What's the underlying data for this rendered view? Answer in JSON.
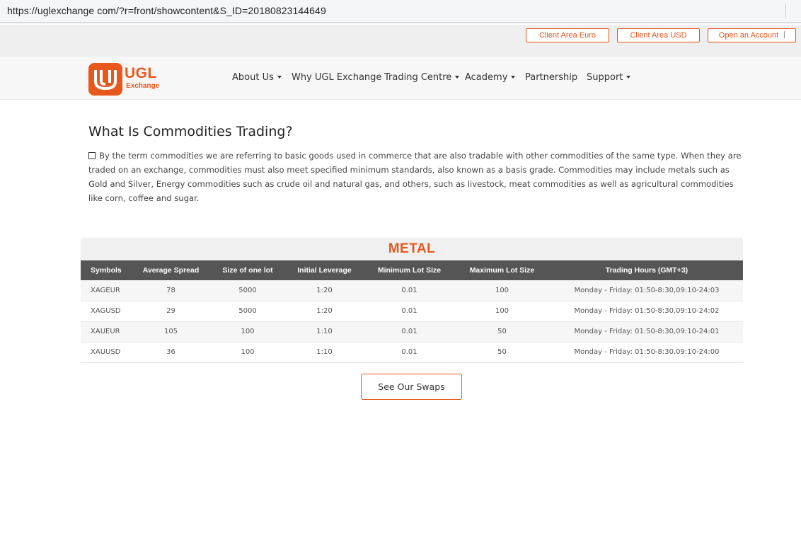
{
  "browser": {
    "url": "https://uglexchange com/?r=front/showcontent&S_ID=20180823144649"
  },
  "top_buttons": {
    "client_euro": "Client Area Euro",
    "client_usd": "Client Area USD",
    "open_account": "Open an Account"
  },
  "logo": {
    "name": "UGL",
    "sub": "Exchange",
    "color": "#e8581c"
  },
  "nav": {
    "about": "About Us",
    "why": "Why UGL Exchange",
    "trading": "Trading Centre",
    "academy": "Academy",
    "partnership": "Partnership",
    "support": "Support"
  },
  "content": {
    "heading": "What Is Commodities Trading?",
    "paragraph": "By the term commodities we are referring to basic goods used in commerce that are also tradable with other commodities of the same type. When they are traded on an exchange, commodities must also meet specified minimum standards, also known as a basis grade. Commodities may include metals such as Gold and Silver, Energy commodities such as crude oil and natural gas, and others, such as livestock, meat commodities as well as agricultural commodities like corn, coffee and sugar."
  },
  "metal_table": {
    "title": "METAL",
    "headers": [
      "Symbols",
      "Average Spread",
      "Size of one lot",
      "Initial Leverage",
      "Minimum Lot Size",
      "Maximum Lot Size",
      "Trading Hours (GMT+3)"
    ],
    "rows": [
      [
        "XAGEUR",
        "78",
        "5000",
        "1:20",
        "0.01",
        "100",
        "Monday - Friday: 01:50-8:30,09:10-24:03"
      ],
      [
        "XAGUSD",
        "29",
        "5000",
        "1:20",
        "0.01",
        "100",
        "Monday - Friday: 01:50-8:30,09:10-24:02"
      ],
      [
        "XAUEUR",
        "105",
        "100",
        "1:10",
        "0.01",
        "50",
        "Monday - Friday: 01:50-8:30,09:10-24:01"
      ],
      [
        "XAUUSD",
        "36",
        "100",
        "1:10",
        "0.01",
        "50",
        "Monday - Friday: 01:50-8:30,09:10-24:00"
      ]
    ]
  },
  "swaps_button": "See Our Swaps"
}
